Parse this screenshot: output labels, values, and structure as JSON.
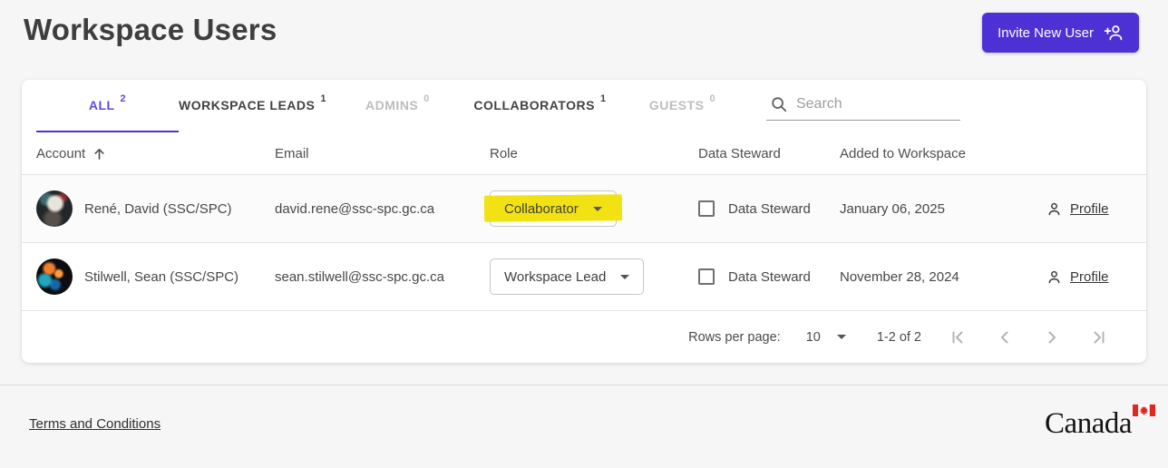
{
  "header": {
    "title": "Workspace Users",
    "invite_button_label": "Invite New User"
  },
  "tabs": [
    {
      "label": "ALL",
      "count": "2",
      "state": "active"
    },
    {
      "label": "WORKSPACE LEADS",
      "count": "1",
      "state": "normal"
    },
    {
      "label": "ADMINS",
      "count": "0",
      "state": "disabled"
    },
    {
      "label": "COLLABORATORS",
      "count": "1",
      "state": "normal"
    },
    {
      "label": "GUESTS",
      "count": "0",
      "state": "disabled"
    }
  ],
  "search": {
    "placeholder": "Search"
  },
  "table": {
    "headers": {
      "account": "Account",
      "email": "Email",
      "role": "Role",
      "data_steward": "Data Steward",
      "added": "Added to Workspace"
    },
    "rows": [
      {
        "name": "René, David (SSC/SPC)",
        "email": "david.rene@ssc-spc.gc.ca",
        "role": "Collaborator",
        "role_highlighted": true,
        "data_steward_label": "Data Steward",
        "data_steward_checked": false,
        "added": "January 06, 2025",
        "profile_label": "Profile"
      },
      {
        "name": "Stilwell, Sean (SSC/SPC)",
        "email": "sean.stilwell@ssc-spc.gc.ca",
        "role": "Workspace Lead",
        "role_highlighted": false,
        "data_steward_label": "Data Steward",
        "data_steward_checked": false,
        "added": "November 28, 2024",
        "profile_label": "Profile"
      }
    ]
  },
  "pagination": {
    "rows_per_page_label": "Rows per page:",
    "rows_per_page_value": "10",
    "range_label": "1-2 of 2"
  },
  "footer": {
    "terms_label": "Terms and Conditions",
    "wordmark": "Canada"
  },
  "colors": {
    "accent": "#4e31d5",
    "active_tab": "#5d4be0",
    "highlight": "#f2e213",
    "card_background": "#ffffff",
    "page_background": "#f6f6f6"
  }
}
